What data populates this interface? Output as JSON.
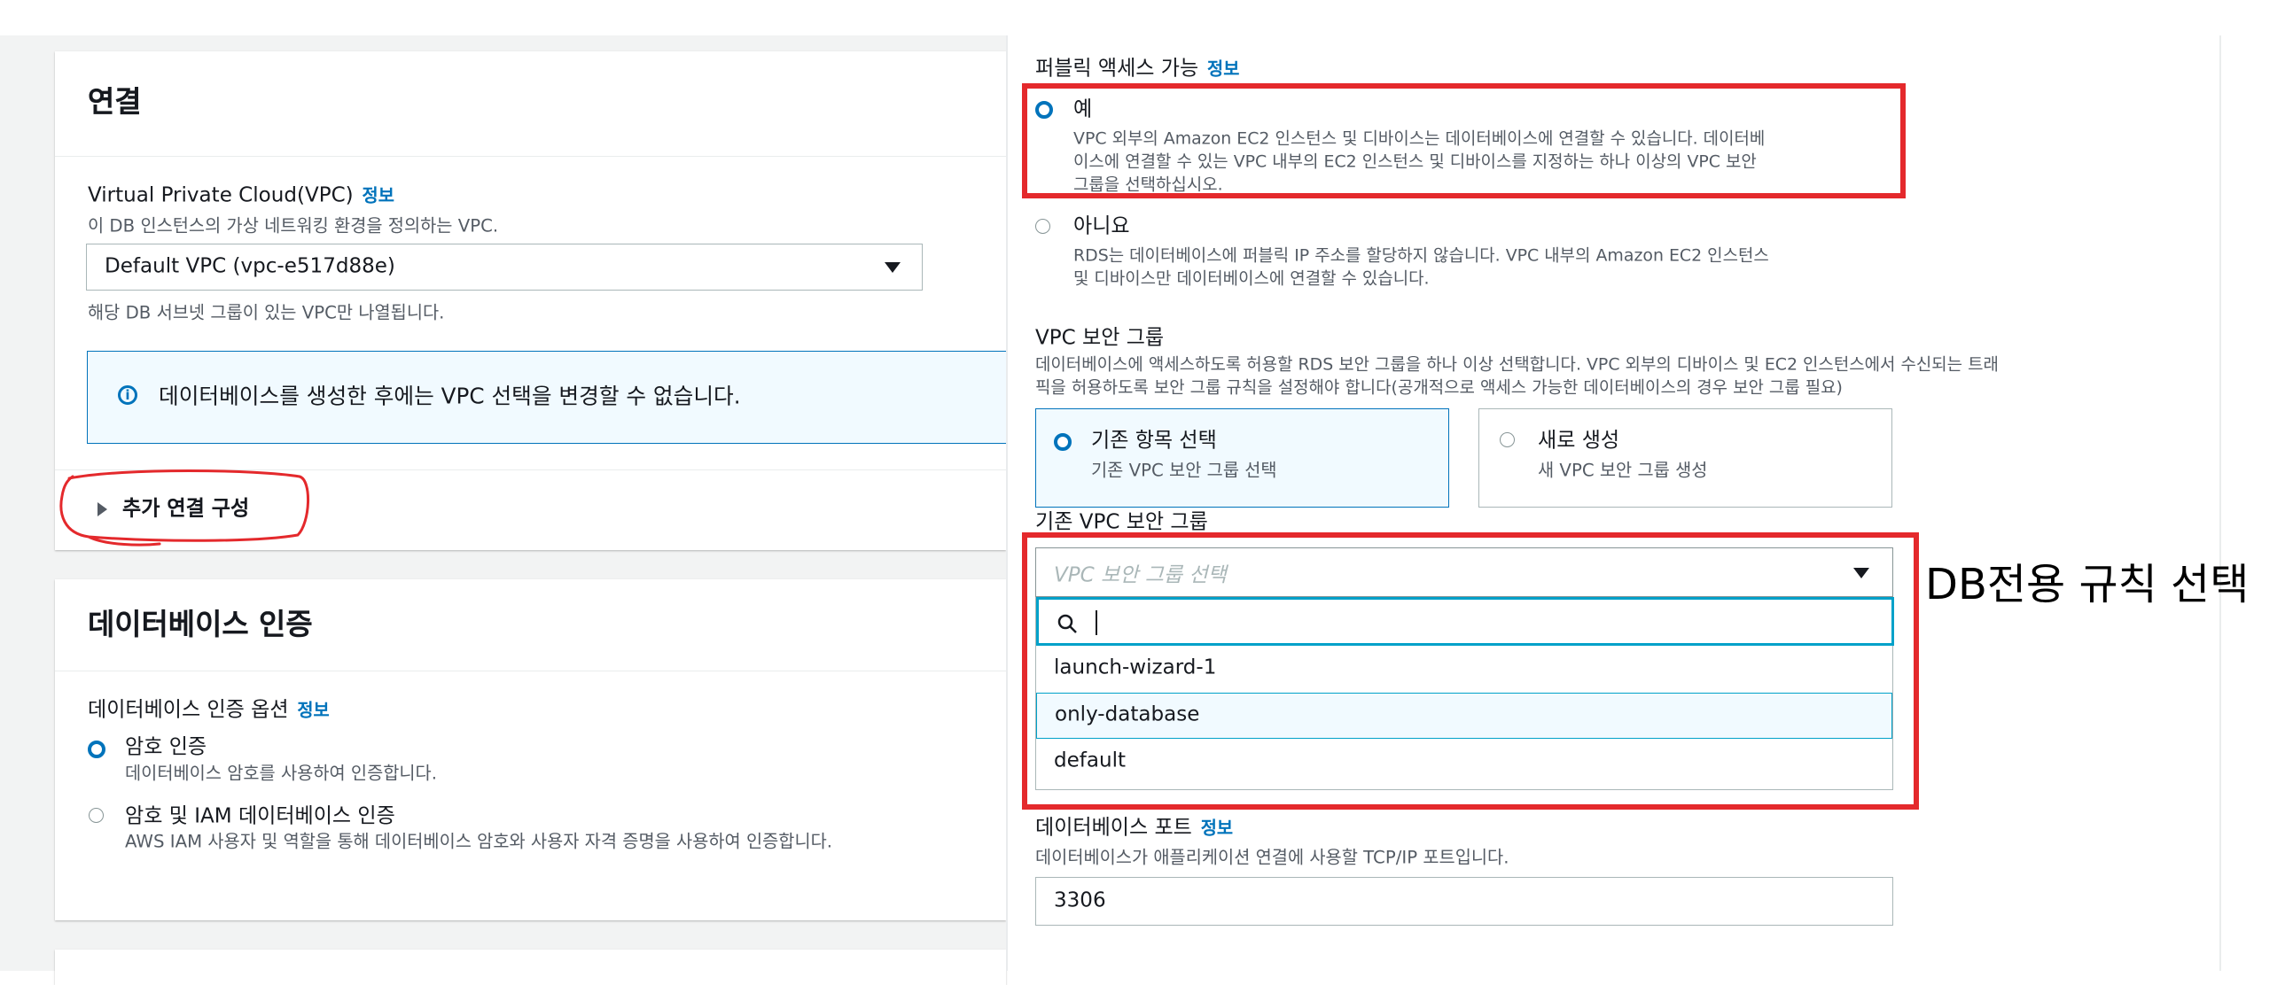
{
  "left": {
    "connectivity": {
      "title": "연결",
      "vpc_label": "Virtual Private Cloud(VPC)",
      "vpc_info": "정보",
      "vpc_desc": "이 DB 인스턴스의 가상 네트워킹 환경을 정의하는 VPC.",
      "vpc_value": "Default VPC (vpc-e517d88e)",
      "vpc_hint": "해당 DB 서브넷 그룹이 있는 VPC만 나열됩니다.",
      "alert_text": "데이터베이스를 생성한 후에는 VPC 선택을 변경할 수 없습니다.",
      "additional_config": "추가 연결 구성"
    },
    "auth": {
      "title": "데이터베이스 인증",
      "options_label": "데이터베이스 인증 옵션",
      "options_info": "정보",
      "opt1_label": "암호 인증",
      "opt1_desc": "데이터베이스 암호를 사용하여 인증합니다.",
      "opt2_label": "암호 및 IAM 데이터베이스 인증",
      "opt2_desc": "AWS IAM 사용자 및 역할을 통해 데이터베이스 암호와 사용자 자격 증명을 사용하여 인증합니다."
    }
  },
  "right": {
    "public_access": {
      "label": "퍼블릭 액세스 가능",
      "info": "정보",
      "yes_label": "예",
      "yes_desc_1": "VPC 외부의 Amazon EC2 인스턴스 및 디바이스는 데이터베이스에 연결할 수 있습니다. 데이터베",
      "yes_desc_2": "이스에 연결할 수 있는 VPC 내부의 EC2 인스턴스 및 디바이스를 지정하는 하나 이상의 VPC 보안",
      "yes_desc_3": "그룹을 선택하십시오.",
      "no_label": "아니요",
      "no_desc_1": "RDS는 데이터베이스에 퍼블릭 IP 주소를 할당하지 않습니다. VPC 내부의 Amazon EC2 인스턴스",
      "no_desc_2": "및 디바이스만 데이터베이스에 연결할 수 있습니다."
    },
    "sg": {
      "label": "VPC 보안 그룹",
      "desc_1": "데이터베이스에 액세스하도록 허용할 RDS 보안 그룹을 하나 이상 선택합니다. VPC 외부의 디바이스 및 EC2 인스턴스에서 수신되는 트래",
      "desc_2": "픽을 허용하도록 보안 그룹 규칙을 설정해야 합니다(공개적으로 액세스 가능한 데이터베이스의 경우 보안 그룹 필요)",
      "tile1_title": "기존 항목 선택",
      "tile1_desc": "기존 VPC 보안 그룹 선택",
      "tile2_title": "새로 생성",
      "tile2_desc": "새 VPC 보안 그룹 생성",
      "existing_label": "기존 VPC 보안 그룹",
      "select_placeholder": "VPC 보안 그룹 선택",
      "options": [
        "launch-wizard-1",
        "only-database",
        "default"
      ]
    },
    "port": {
      "label": "데이터베이스 포트",
      "info": "정보",
      "desc": "데이터베이스가 애플리케이션 연결에 사용할 TCP/IP 포트입니다.",
      "value": "3306"
    }
  },
  "annotation": "DB전용 규칙 선택",
  "colors": {
    "accent": "#0073bb",
    "annotation_red": "#e4292c",
    "bg_gray": "#f2f3f3"
  }
}
